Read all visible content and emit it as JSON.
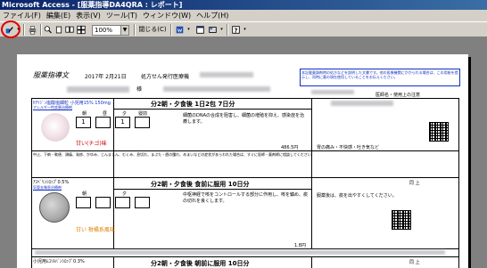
{
  "window": {
    "title": "Microsoft Access - [服薬指導DA4QRA : レポート]"
  },
  "menu": [
    "ファイル(F)",
    "編集(E)",
    "表示(V)",
    "ツール(T)",
    "ウィンドウ(W)",
    "ヘルプ(H)"
  ],
  "toolbar": {
    "zoom_value": "100%",
    "close_label": "閉じる(C)"
  },
  "report": {
    "header": {
      "title": "服薬指導文",
      "date": "2017年 2月21日",
      "hospital_label": "処方せん発行医療機",
      "patient_suffix": "様",
      "notice": "本記載薬調剤時の処方などを説明した文書です。他の医療機関にかかられる場合は、この用紙を提示し、同時に薬の現在使用していることをお伝えください。",
      "remarks_label": "医師名・使用上の注意"
    },
    "drugs": [
      {
        "name": "ｾﾁﾘｼﾞﾝ塩酸塩細粒 小児用15% 150mg",
        "category": "アレルギー性疾患治療剤",
        "dose_labels": [
          "朝",
          "昼",
          "夕",
          "寝前"
        ],
        "dose_values": [
          "1",
          "",
          "1",
          ""
        ],
        "dosage": "分2朝・夕食後 1日2包 7日分",
        "effect": "細菌のDNAの合成を阻害し、細菌の増殖を抑え、感染症を治療します。",
        "taste": "甘い(チゴ)味",
        "price": "486.5円",
        "side_effect": "胃の痛み・不快感・吐き気など",
        "caution": "中止、下痢・軟便、頭痛、発疹、かゆみ、じんましん、むくみ、息切れ、まぶた・唇の腫れ、めまいなどの症状があらわれた場合は、すぐに医師・薬剤師に相談してください。"
      },
      {
        "name": "ｱｽﾍﾞﾘﾝｼﾛｯﾌﾟ0.5%",
        "category": "気管支喘息治療剤",
        "dosage": "分2朝・夕食後 食前に服用 10日分",
        "effect": "中枢神経で咳をコントロールする部分に作用し、咳を鎮め、痰の切れを良くします。",
        "taste": "甘い 柑橘系風味",
        "price": "1.8円",
        "side_effect": "服薬後は、痰を出やすくしてください。"
      },
      {
        "name": "小児用ﾑｺｿﾙﾊﾞﾝｼﾛｯﾌﾟ0.3%",
        "dosage": "分2朝・夕食後 朝前に服用 10日分"
      }
    ]
  },
  "colors": {
    "title_bar": "#0a246a",
    "accent_red": "#e00000",
    "link_blue": "#1030c0"
  }
}
